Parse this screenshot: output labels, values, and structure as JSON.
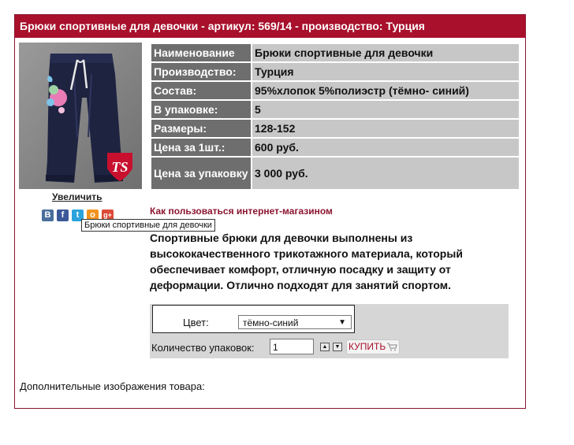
{
  "header": {
    "title": "Брюки спортивные для девочки - артикул: 569/14 - производство: Турция"
  },
  "gallery": {
    "zoom_label": "Увеличить",
    "brand_badge": "TS"
  },
  "social": {
    "icons": [
      {
        "name": "vk-icon",
        "glyph": "B",
        "color": "#4a6f9c"
      },
      {
        "name": "facebook-icon",
        "glyph": "f",
        "color": "#3b5998"
      },
      {
        "name": "twitter-icon",
        "glyph": "t",
        "color": "#2aa3de"
      },
      {
        "name": "odnoklassniki-icon",
        "glyph": "o",
        "color": "#f39320"
      },
      {
        "name": "google-plus-icon",
        "glyph": "g+",
        "color": "#dc4a38"
      }
    ],
    "tooltip": "Брюки спортивные для девочки"
  },
  "specs": [
    {
      "key": "Наименование",
      "value": "Брюки спортивные для девочки"
    },
    {
      "key": "Производство:",
      "value": "Турция"
    },
    {
      "key": "Состав:",
      "value": "95%хлопок 5%полиэстр (тёмно- синий)"
    },
    {
      "key": "В упаковке:",
      "value": "5"
    },
    {
      "key": "Размеры:",
      "value": "128-152"
    },
    {
      "key": "Цена за 1шт.:",
      "value": "600 руб."
    },
    {
      "key": "Цена за упаковку",
      "value": "3 000 руб."
    }
  ],
  "help_link": "Как пользоваться интернет-магазином",
  "description": "Спортивные брюки для девочки выполнены из высококачественного трикотажного материала, который обеспечивает комфорт, отличную посадку и защиту от деформации. Отлично подходят для занятий спортом.",
  "order": {
    "color_label": "Цвет:",
    "color_value": "тёмно-синий",
    "qty_label": "Количество упаковок:",
    "qty_value": "1",
    "buy_label": "КУПИТЬ"
  },
  "extra_images_label": "Дополнительные изображения товара:",
  "colors": {
    "header": "#a8102c",
    "border": "#8b1530",
    "key_cell": "#6e6e6e",
    "value_cell": "#c7c7c7",
    "help_link": "#8b1530"
  }
}
